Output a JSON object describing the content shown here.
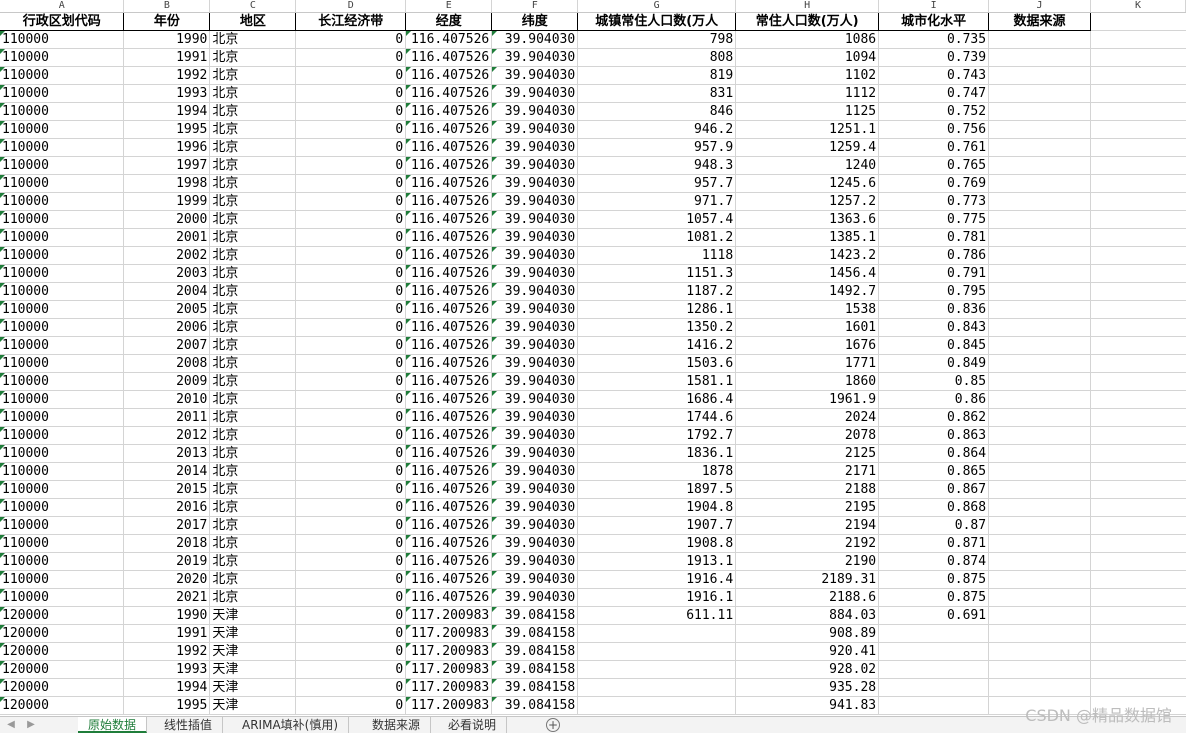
{
  "columns": [
    "A",
    "B",
    "C",
    "D",
    "E",
    "F",
    "G",
    "H",
    "I",
    "J",
    "K"
  ],
  "headers": [
    "行政区划代码",
    "年份",
    "地区",
    "长江经济带",
    "经度",
    "纬度",
    "城镇常住人口数(万人",
    "常住人口数(万人)",
    "城市化水平",
    "数据来源",
    ""
  ],
  "rows": [
    [
      "110000",
      "1990",
      "北京",
      "0",
      "116.407526",
      "39.904030",
      "798",
      "1086",
      "0.735"
    ],
    [
      "110000",
      "1991",
      "北京",
      "0",
      "116.407526",
      "39.904030",
      "808",
      "1094",
      "0.739"
    ],
    [
      "110000",
      "1992",
      "北京",
      "0",
      "116.407526",
      "39.904030",
      "819",
      "1102",
      "0.743"
    ],
    [
      "110000",
      "1993",
      "北京",
      "0",
      "116.407526",
      "39.904030",
      "831",
      "1112",
      "0.747"
    ],
    [
      "110000",
      "1994",
      "北京",
      "0",
      "116.407526",
      "39.904030",
      "846",
      "1125",
      "0.752"
    ],
    [
      "110000",
      "1995",
      "北京",
      "0",
      "116.407526",
      "39.904030",
      "946.2",
      "1251.1",
      "0.756"
    ],
    [
      "110000",
      "1996",
      "北京",
      "0",
      "116.407526",
      "39.904030",
      "957.9",
      "1259.4",
      "0.761"
    ],
    [
      "110000",
      "1997",
      "北京",
      "0",
      "116.407526",
      "39.904030",
      "948.3",
      "1240",
      "0.765"
    ],
    [
      "110000",
      "1998",
      "北京",
      "0",
      "116.407526",
      "39.904030",
      "957.7",
      "1245.6",
      "0.769"
    ],
    [
      "110000",
      "1999",
      "北京",
      "0",
      "116.407526",
      "39.904030",
      "971.7",
      "1257.2",
      "0.773"
    ],
    [
      "110000",
      "2000",
      "北京",
      "0",
      "116.407526",
      "39.904030",
      "1057.4",
      "1363.6",
      "0.775"
    ],
    [
      "110000",
      "2001",
      "北京",
      "0",
      "116.407526",
      "39.904030",
      "1081.2",
      "1385.1",
      "0.781"
    ],
    [
      "110000",
      "2002",
      "北京",
      "0",
      "116.407526",
      "39.904030",
      "1118",
      "1423.2",
      "0.786"
    ],
    [
      "110000",
      "2003",
      "北京",
      "0",
      "116.407526",
      "39.904030",
      "1151.3",
      "1456.4",
      "0.791"
    ],
    [
      "110000",
      "2004",
      "北京",
      "0",
      "116.407526",
      "39.904030",
      "1187.2",
      "1492.7",
      "0.795"
    ],
    [
      "110000",
      "2005",
      "北京",
      "0",
      "116.407526",
      "39.904030",
      "1286.1",
      "1538",
      "0.836"
    ],
    [
      "110000",
      "2006",
      "北京",
      "0",
      "116.407526",
      "39.904030",
      "1350.2",
      "1601",
      "0.843"
    ],
    [
      "110000",
      "2007",
      "北京",
      "0",
      "116.407526",
      "39.904030",
      "1416.2",
      "1676",
      "0.845"
    ],
    [
      "110000",
      "2008",
      "北京",
      "0",
      "116.407526",
      "39.904030",
      "1503.6",
      "1771",
      "0.849"
    ],
    [
      "110000",
      "2009",
      "北京",
      "0",
      "116.407526",
      "39.904030",
      "1581.1",
      "1860",
      "0.85"
    ],
    [
      "110000",
      "2010",
      "北京",
      "0",
      "116.407526",
      "39.904030",
      "1686.4",
      "1961.9",
      "0.86"
    ],
    [
      "110000",
      "2011",
      "北京",
      "0",
      "116.407526",
      "39.904030",
      "1744.6",
      "2024",
      "0.862"
    ],
    [
      "110000",
      "2012",
      "北京",
      "0",
      "116.407526",
      "39.904030",
      "1792.7",
      "2078",
      "0.863"
    ],
    [
      "110000",
      "2013",
      "北京",
      "0",
      "116.407526",
      "39.904030",
      "1836.1",
      "2125",
      "0.864"
    ],
    [
      "110000",
      "2014",
      "北京",
      "0",
      "116.407526",
      "39.904030",
      "1878",
      "2171",
      "0.865"
    ],
    [
      "110000",
      "2015",
      "北京",
      "0",
      "116.407526",
      "39.904030",
      "1897.5",
      "2188",
      "0.867"
    ],
    [
      "110000",
      "2016",
      "北京",
      "0",
      "116.407526",
      "39.904030",
      "1904.8",
      "2195",
      "0.868"
    ],
    [
      "110000",
      "2017",
      "北京",
      "0",
      "116.407526",
      "39.904030",
      "1907.7",
      "2194",
      "0.87"
    ],
    [
      "110000",
      "2018",
      "北京",
      "0",
      "116.407526",
      "39.904030",
      "1908.8",
      "2192",
      "0.871"
    ],
    [
      "110000",
      "2019",
      "北京",
      "0",
      "116.407526",
      "39.904030",
      "1913.1",
      "2190",
      "0.874"
    ],
    [
      "110000",
      "2020",
      "北京",
      "0",
      "116.407526",
      "39.904030",
      "1916.4",
      "2189.31",
      "0.875"
    ],
    [
      "110000",
      "2021",
      "北京",
      "0",
      "116.407526",
      "39.904030",
      "1916.1",
      "2188.6",
      "0.875"
    ],
    [
      "120000",
      "1990",
      "天津",
      "0",
      "117.200983",
      "39.084158",
      "611.11",
      "884.03",
      "0.691"
    ],
    [
      "120000",
      "1991",
      "天津",
      "0",
      "117.200983",
      "39.084158",
      "",
      "908.89",
      ""
    ],
    [
      "120000",
      "1992",
      "天津",
      "0",
      "117.200983",
      "39.084158",
      "",
      "920.41",
      ""
    ],
    [
      "120000",
      "1993",
      "天津",
      "0",
      "117.200983",
      "39.084158",
      "",
      "928.02",
      ""
    ],
    [
      "120000",
      "1994",
      "天津",
      "0",
      "117.200983",
      "39.084158",
      "",
      "935.28",
      ""
    ],
    [
      "120000",
      "1995",
      "天津",
      "0",
      "117.200983",
      "39.084158",
      "",
      "941.83",
      ""
    ]
  ],
  "tabs": [
    "原始数据",
    "线性插值",
    "ARIMA填补(慎用)",
    "数据来源",
    "必看说明"
  ],
  "active_tab_index": 0,
  "watermark": "CSDN @精品数据馆",
  "colors": {
    "accent": "#1f7d3a",
    "grid": "#d4d4d4"
  }
}
